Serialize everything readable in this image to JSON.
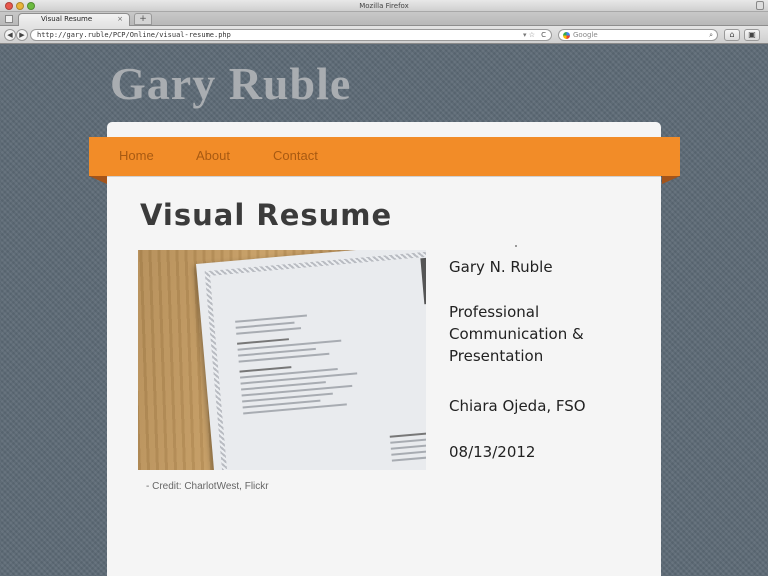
{
  "browser": {
    "window_title": "Mozilla Firefox",
    "tab_label": "Visual Resume",
    "tab_close": "×",
    "new_tab": "+",
    "url": "http://gary.ruble/PCP/Online/visual-resume.php",
    "search_placeholder": "Google",
    "icons": [
      "back-icon",
      "forward-icon",
      "star-icon",
      "reload-icon",
      "search-icon",
      "home-icon",
      "addon-icon"
    ]
  },
  "site": {
    "title": "Gary Ruble",
    "nav": [
      "Home",
      "About",
      "Contact"
    ],
    "accent_color": "#f28c28"
  },
  "main": {
    "heading": "Visual Resume",
    "photo_credit": "- Credit: CharlotWest, Flickr",
    "info": {
      "name": "Gary N. Ruble",
      "course_line1": "Professional",
      "course_line2": "Communication &",
      "course_line3": "Presentation",
      "instructor": "Chiara Ojeda, FSO",
      "date": "08/13/2012"
    }
  }
}
